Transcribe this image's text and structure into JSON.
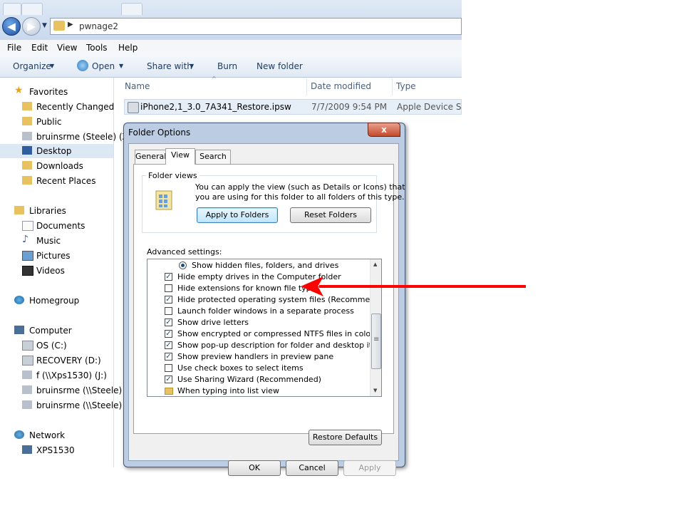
{
  "window": {
    "address_path": "pwnage2",
    "back_glyph": "◀",
    "forward_glyph": "▶"
  },
  "menubar": [
    "File",
    "Edit",
    "View",
    "Tools",
    "Help"
  ],
  "toolbar": {
    "organize": "Organize",
    "open": "Open",
    "share_with": "Share with",
    "burn": "Burn",
    "new_folder": "New folder"
  },
  "navpane": {
    "favorites": {
      "header": "Favorites",
      "items": [
        "Recently Changed",
        "Public",
        "bruinsrme (Steele) (Z",
        "Desktop",
        "Downloads",
        "Recent Places"
      ]
    },
    "libraries": {
      "header": "Libraries",
      "items": [
        "Documents",
        "Music",
        "Pictures",
        "Videos"
      ]
    },
    "homegroup": "Homegroup",
    "computer": {
      "header": "Computer",
      "items": [
        "OS (C:)",
        "RECOVERY (D:)",
        "f (\\\\Xps1530) (J:)",
        "bruinsrme (\\\\Steele)",
        "bruinsrme (\\\\Steele)"
      ]
    },
    "network": {
      "header": "Network",
      "items": [
        "XPS1530"
      ]
    }
  },
  "filelist": {
    "columns": [
      "Name",
      "Date modified",
      "Type"
    ],
    "rows": [
      {
        "name": "iPhone2,1_3.0_7A341_Restore.ipsw",
        "date": "7/7/2009 9:54 PM",
        "type": "Apple Device Soft"
      }
    ]
  },
  "dialog": {
    "title": "Folder Options",
    "close_glyph": "x",
    "tabs": [
      "General",
      "View",
      "Search"
    ],
    "active_tab": "View",
    "folder_views": {
      "legend": "Folder views",
      "description_line1": "You can apply the view (such as Details or Icons) that",
      "description_line2": "you are using for this folder to all folders of this type.",
      "apply_button": "Apply to Folders",
      "reset_button": "Reset Folders"
    },
    "advanced_label": "Advanced settings:",
    "settings": [
      {
        "label": "Show hidden files, folders, and drives",
        "kind": "radio",
        "checked": true
      },
      {
        "label": "Hide empty drives in the Computer folder",
        "kind": "checkbox",
        "checked": true
      },
      {
        "label": "Hide extensions for known file types",
        "kind": "checkbox",
        "checked": false
      },
      {
        "label": "Hide protected operating system files (Recommended)",
        "kind": "checkbox",
        "checked": true
      },
      {
        "label": "Launch folder windows in a separate process",
        "kind": "checkbox",
        "checked": false
      },
      {
        "label": "Show drive letters",
        "kind": "checkbox",
        "checked": true
      },
      {
        "label": "Show encrypted or compressed NTFS files in color",
        "kind": "checkbox",
        "checked": true
      },
      {
        "label": "Show pop-up description for folder and desktop items",
        "kind": "checkbox",
        "checked": true
      },
      {
        "label": "Show preview handlers in preview pane",
        "kind": "checkbox",
        "checked": true
      },
      {
        "label": "Use check boxes to select items",
        "kind": "checkbox",
        "checked": false
      },
      {
        "label": "Use Sharing Wizard (Recommended)",
        "kind": "checkbox",
        "checked": true
      },
      {
        "label": "When typing into list view",
        "kind": "folder",
        "checked": false
      }
    ],
    "restore_defaults": "Restore Defaults",
    "ok": "OK",
    "cancel": "Cancel",
    "apply": "Apply"
  },
  "colors": {
    "annotation_arrow": "#ff0000",
    "selection": "#dde8f5"
  },
  "icons": {
    "check_glyph": "✓",
    "scroll_up": "▲",
    "scroll_down": "▼",
    "dropdown": "▼",
    "grip": "≡"
  }
}
